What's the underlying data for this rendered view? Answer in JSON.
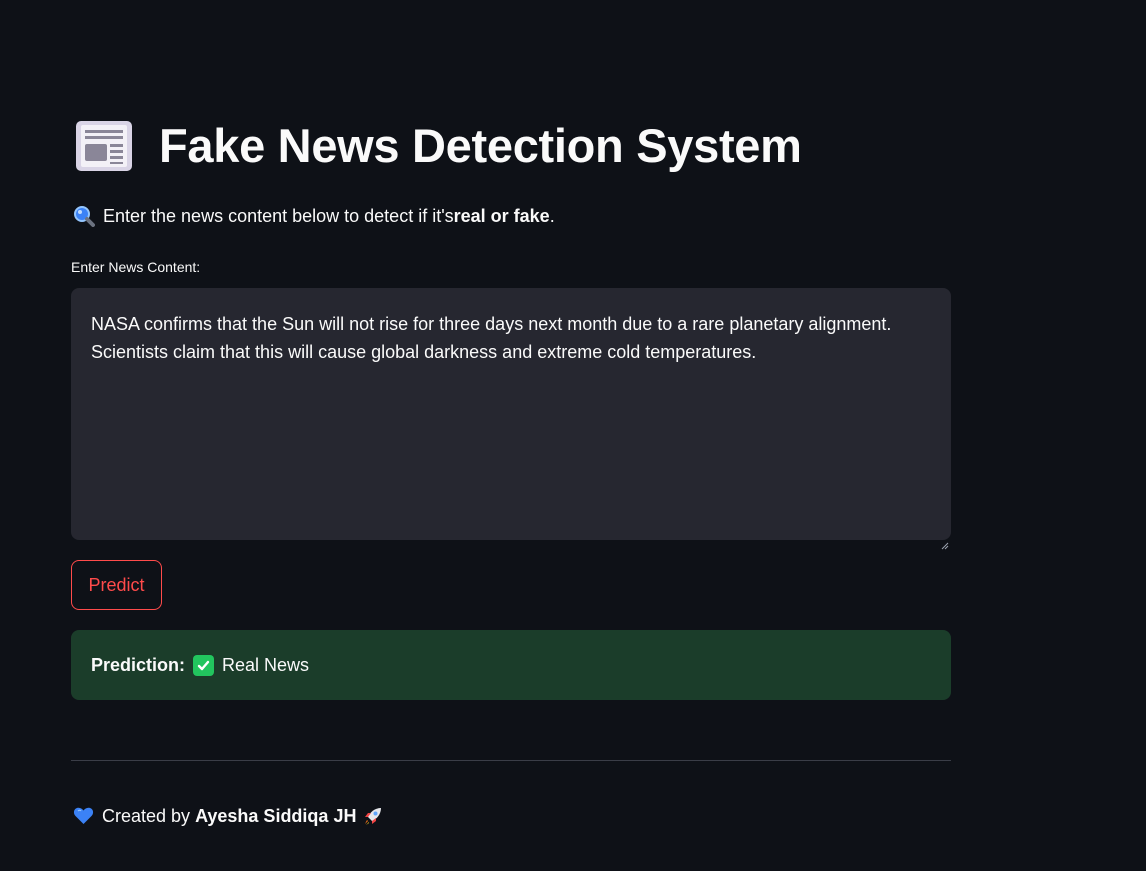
{
  "header": {
    "title": "Fake News Detection System",
    "icon": "newspaper-icon"
  },
  "intro": {
    "icon": "magnifier-icon",
    "prefix": "Enter the news content below to detect if it's ",
    "emphasis": "real or fake",
    "suffix": "."
  },
  "input": {
    "label": "Enter News Content:",
    "value": "NASA confirms that the Sun will not rise for three days next month due to a rare planetary alignment. Scientists claim that this will cause global darkness and extreme cold temperatures."
  },
  "actions": {
    "predict_label": "Predict",
    "accent_color": "#ff4b4b"
  },
  "result": {
    "label": "Prediction:",
    "icon": "check-icon",
    "value": "Real News",
    "background_color": "#1b3d2a"
  },
  "footer": {
    "prefix": "Created by",
    "author": "Ayesha Siddiqa JH",
    "left_icon": "blue-heart-icon",
    "right_icon": "rocket-icon"
  }
}
